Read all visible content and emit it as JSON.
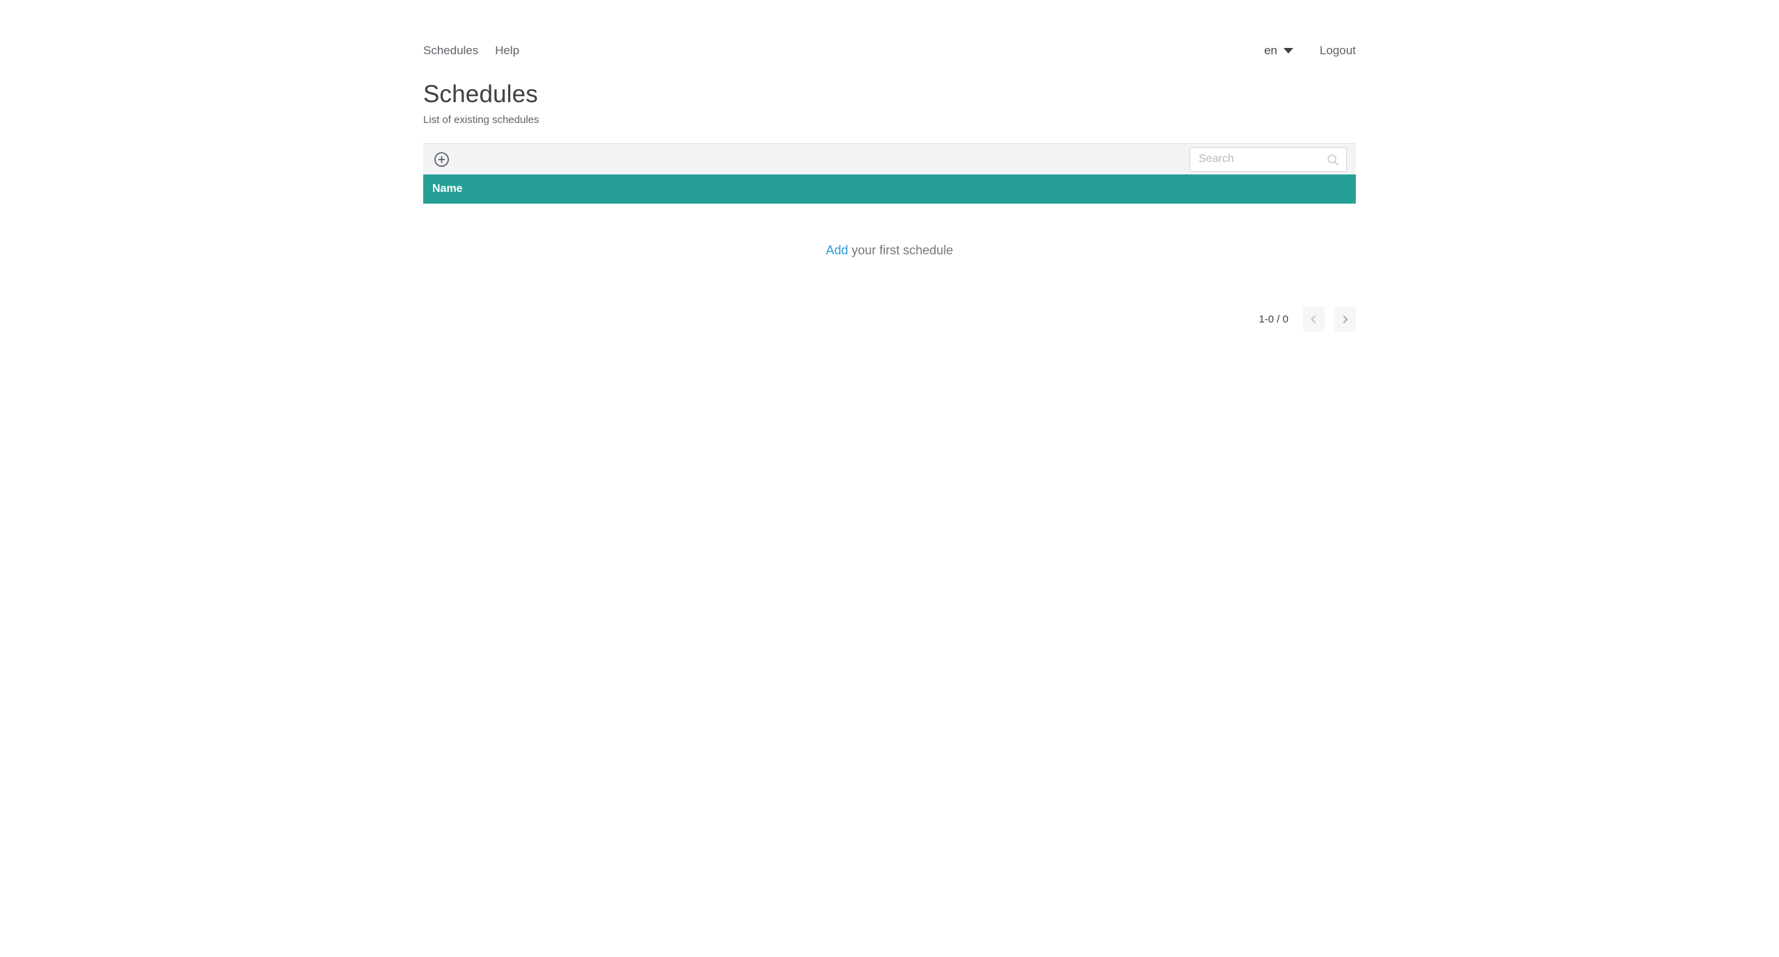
{
  "nav": {
    "left": [
      {
        "label": "Schedules"
      },
      {
        "label": "Help"
      }
    ],
    "language": {
      "value": "en",
      "icon": "caret-down-icon"
    },
    "logout_label": "Logout"
  },
  "page": {
    "title": "Schedules",
    "subtitle": "List of existing schedules"
  },
  "toolbar": {
    "add_icon": "plus-circle-icon",
    "search": {
      "placeholder": "Search",
      "value": "",
      "icon": "search-icon"
    }
  },
  "table": {
    "columns": [
      {
        "label": "Name"
      }
    ],
    "rows": [],
    "empty_state": {
      "link_label": "Add",
      "text": "your first schedule"
    }
  },
  "pagination": {
    "range_label": "1-0 / 0",
    "prev_icon": "chevron-left-icon",
    "next_icon": "chevron-right-icon"
  },
  "colors": {
    "accent_teal": "#26a096",
    "toolbar_bg": "#f2f3f5",
    "link_blue": "#2d9cdb",
    "header_text": "#ffffff"
  }
}
